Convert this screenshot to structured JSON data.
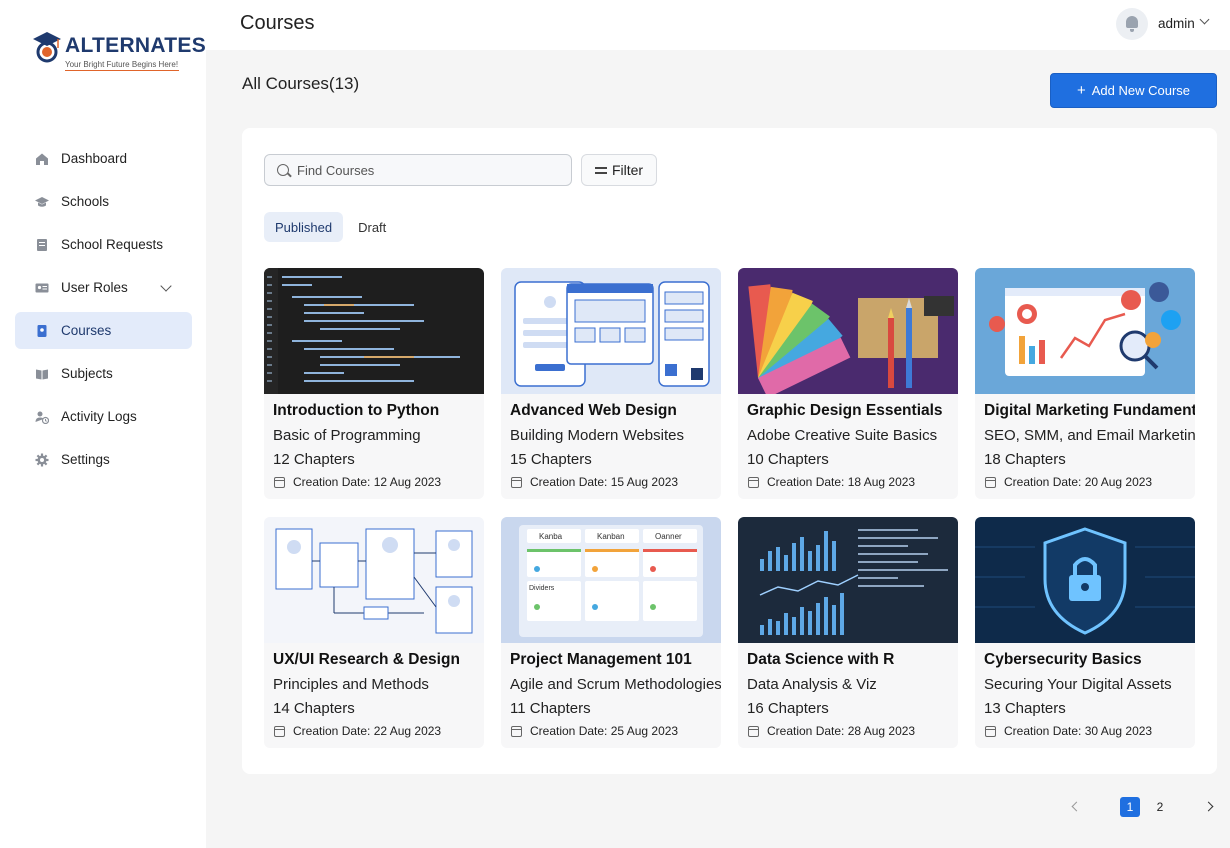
{
  "brand": {
    "name": "ALTERNATES",
    "tagline": "Your Bright Future Begins Here!",
    "primary_color": "#1f6fe0",
    "navy": "#1f3a6e",
    "accent": "#e0642a"
  },
  "sidebar": {
    "items": [
      {
        "label": "Dashboard",
        "icon": "home-icon"
      },
      {
        "label": "Schools",
        "icon": "graduation-cap-icon"
      },
      {
        "label": "School Requests",
        "icon": "document-icon"
      },
      {
        "label": "User Roles",
        "icon": "id-card-icon"
      },
      {
        "label": "Courses",
        "icon": "book-icon"
      },
      {
        "label": "Subjects",
        "icon": "open-book-icon"
      },
      {
        "label": "Activity Logs",
        "icon": "user-clock-icon"
      },
      {
        "label": "Settings",
        "icon": "gear-icon"
      }
    ],
    "active": "Courses"
  },
  "header": {
    "title": "Courses",
    "user": "admin"
  },
  "main": {
    "heading": "All Courses(13)",
    "add_button": "Add New Course",
    "search_placeholder": "Find Courses",
    "filter_label": "Filter",
    "tabs": [
      {
        "label": "Published",
        "active": true
      },
      {
        "label": "Draft",
        "active": false
      }
    ],
    "courses": [
      {
        "title": "Introduction to Python",
        "subtitle": "Basic of Programming",
        "chapters": "12 Chapters",
        "date": "Creation Date: 12 Aug 2023"
      },
      {
        "title": "Advanced Web Design",
        "subtitle": "Building Modern Websites",
        "chapters": "15 Chapters",
        "date": "Creation Date: 15 Aug 2023"
      },
      {
        "title": "Graphic Design Essentials",
        "subtitle": "Adobe Creative Suite Basics",
        "chapters": "10 Chapters",
        "date": "Creation Date: 18 Aug 2023"
      },
      {
        "title": "Digital Marketing Fundamentals",
        "subtitle": "SEO, SMM, and Email Marketing",
        "chapters": "18 Chapters",
        "date": "Creation Date: 20 Aug 2023"
      },
      {
        "title": "UX/UI Research & Design",
        "subtitle": "Principles and Methods",
        "chapters": "14 Chapters",
        "date": "Creation Date: 22 Aug 2023"
      },
      {
        "title": "Project Management 101",
        "subtitle": "Agile and Scrum Methodologies",
        "chapters": "11 Chapters",
        "date": "Creation Date: 25 Aug 2023"
      },
      {
        "title": "Data Science with R",
        "subtitle": "Data Analysis & Viz",
        "chapters": "16 Chapters",
        "date": "Creation Date: 28 Aug 2023"
      },
      {
        "title": "Cybersecurity Basics",
        "subtitle": "Securing Your Digital Assets",
        "chapters": "13 Chapters",
        "date": "Creation Date: 30 Aug 2023"
      }
    ],
    "kanban_labels": [
      "Kanba",
      "Kanban",
      "Oanner"
    ],
    "kanban_note": "Dividers"
  },
  "pagination": {
    "pages": [
      "1",
      "2"
    ],
    "current": "1"
  }
}
